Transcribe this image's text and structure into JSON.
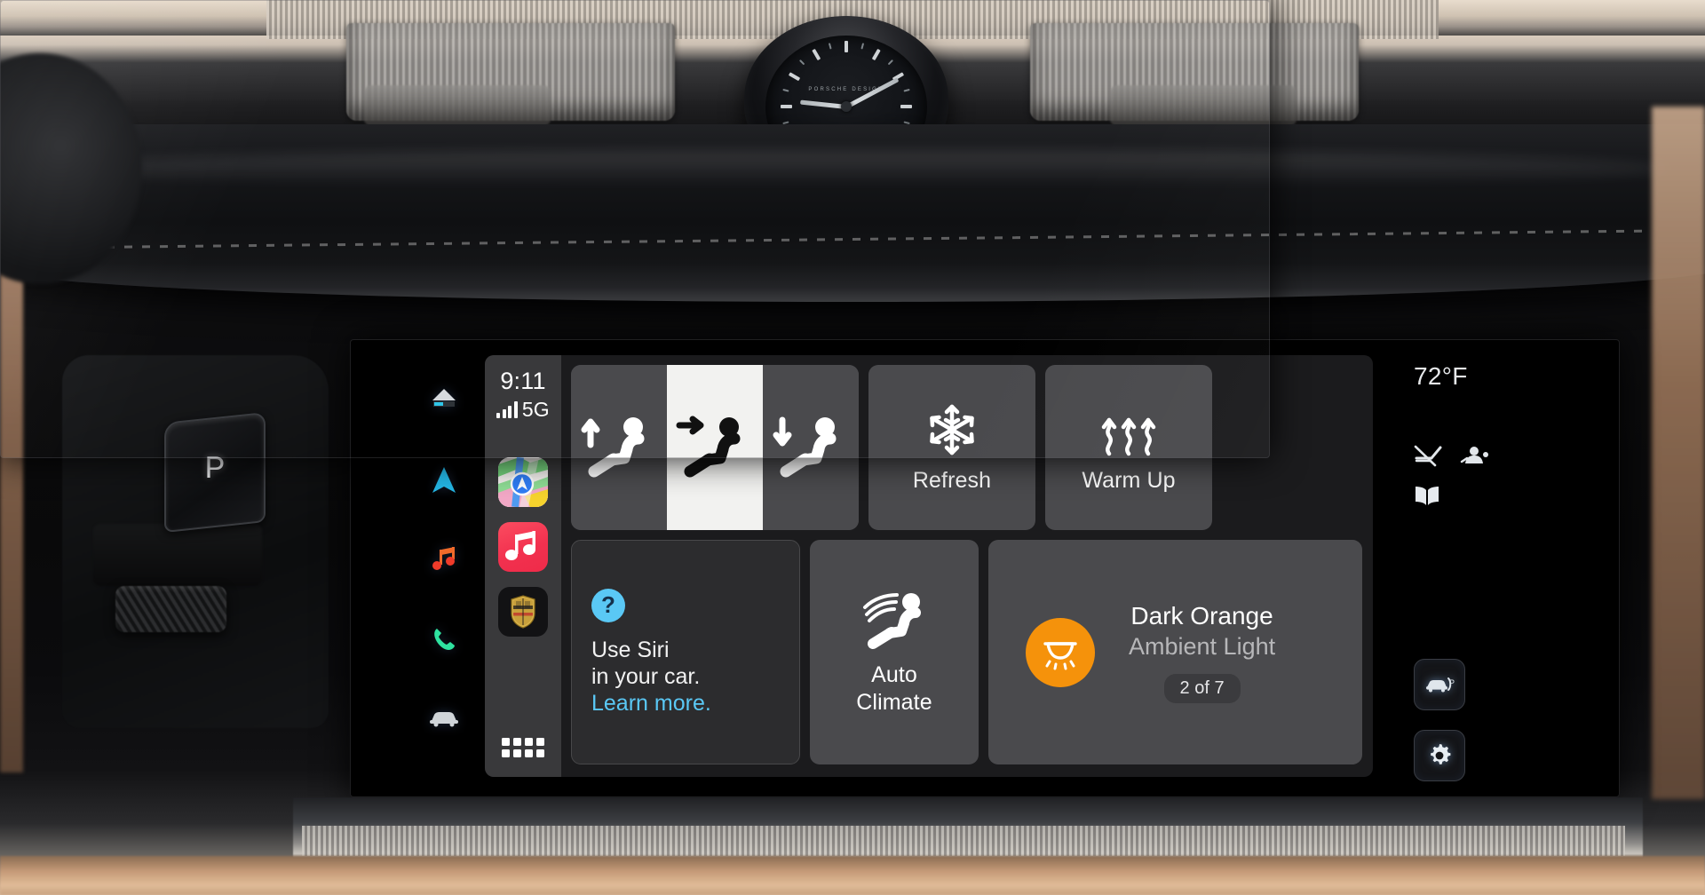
{
  "vehicle": {
    "park_button_label": "P",
    "left_column_icons": [
      {
        "name": "home-screen-icon",
        "label": "Home"
      },
      {
        "name": "navigation-arrow-icon",
        "label": "Navigation"
      },
      {
        "name": "music-note-icon",
        "label": "Media"
      },
      {
        "name": "phone-icon",
        "label": "Phone"
      },
      {
        "name": "car-icon",
        "label": "Vehicle"
      }
    ],
    "right_column": {
      "temperature": "72°F",
      "status_icons": [
        {
          "name": "wiper-off-icon",
          "label": "Wipers off"
        },
        {
          "name": "driver-seat-position-icon",
          "label": "Seat memory"
        },
        {
          "name": "open-book-icon",
          "label": "Manual"
        }
      ],
      "buttons": [
        {
          "name": "parking-assist-button",
          "label": "Parking assist"
        },
        {
          "name": "settings-gear-button",
          "label": "Settings"
        }
      ]
    }
  },
  "carplay": {
    "sidebar": {
      "time": "9:11",
      "network": "5G",
      "signal_bars": 4,
      "apps": [
        {
          "name": "app-icon-maps",
          "label": "Maps"
        },
        {
          "name": "app-icon-music",
          "label": "Music"
        },
        {
          "name": "app-icon-porsche",
          "label": "Porsche"
        }
      ],
      "grid_button": "All apps"
    },
    "seat_segment": {
      "name": "seat-position-segmented-control",
      "options": [
        {
          "name": "seat-raise-option",
          "label": "Raise seat",
          "selected": false
        },
        {
          "name": "seat-forward-option",
          "label": "Move seat forward",
          "selected": true
        },
        {
          "name": "seat-lower-option",
          "label": "Lower seat",
          "selected": false
        }
      ]
    },
    "tiles": {
      "refresh": {
        "label": "Refresh",
        "icon": "snowflake-icon"
      },
      "warm_up": {
        "label": "Warm Up",
        "icon": "heat-waves-icon"
      },
      "auto_climate": {
        "label_line1": "Auto",
        "label_line2": "Climate",
        "icon": "seat-ventilation-icon"
      },
      "siri": {
        "badge": "?",
        "line1": "Use Siri",
        "line2": "in your car.",
        "link": "Learn more."
      },
      "ambient_light": {
        "title": "Dark Orange",
        "subtitle": "Ambient Light",
        "count": "2 of 7",
        "swatch_color": "#f5920b",
        "icon": "ambient-lamp-icon"
      }
    }
  },
  "colors": {
    "tile_bg": "#4a4a4d",
    "panel_bg": "#1b1b1d",
    "sidebar_bg": "#39393b",
    "accent_blue": "#5ac8f5",
    "accent_orange": "#f5920b",
    "selected_tile": "#f2f2f0"
  }
}
